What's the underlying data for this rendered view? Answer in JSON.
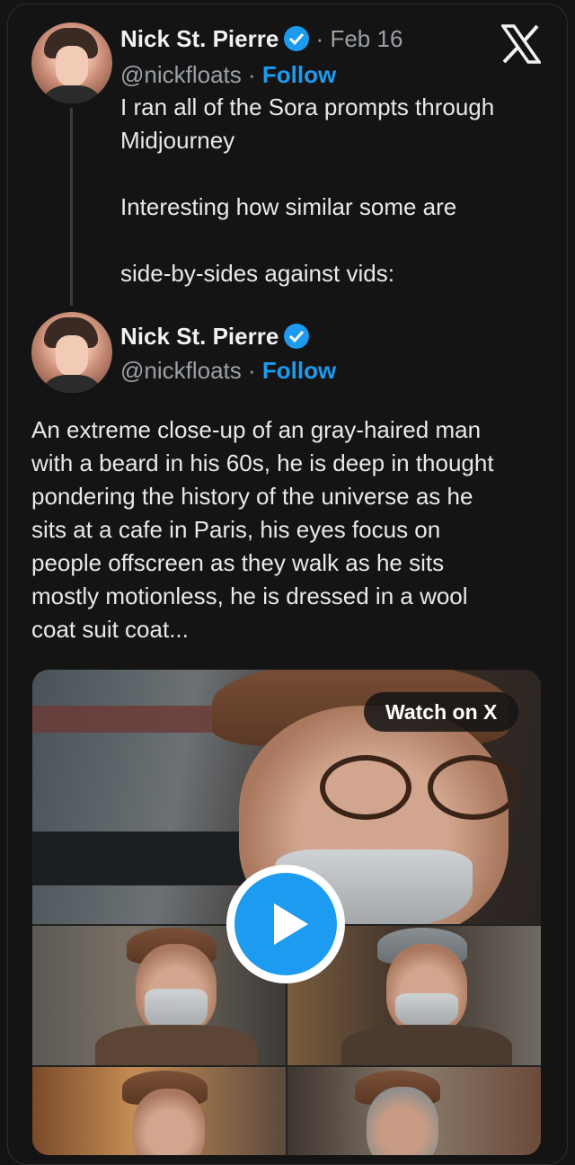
{
  "tweet1": {
    "name": "Nick St. Pierre",
    "date_sep": "·",
    "date": "Feb 16",
    "handle": "@nickfloats",
    "handle_sep": "·",
    "follow": "Follow",
    "text": "I ran all of the Sora prompts through\nMidjourney\n\nInteresting how similar some are\n\nside-by-sides against vids:"
  },
  "tweet2": {
    "name": "Nick St. Pierre",
    "handle": "@nickfloats",
    "handle_sep": "·",
    "follow": "Follow",
    "text": "An extreme close-up of an gray-haired man\nwith a beard in his 60s, he is deep in thought\npondering the history of the universe as he\nsits at a cafe in Paris, his eyes focus on\npeople offscreen as they walk as he sits\nmostly motionless, he is dressed in a wool\ncoat suit coat..."
  },
  "media": {
    "watch_label": "Watch on X"
  },
  "icons": {
    "logo": "x-logo-icon",
    "verified": "verified-badge-icon",
    "play": "play-icon"
  },
  "colors": {
    "background": "#141414",
    "accent": "#1d9bf0",
    "text": "#e7e9ea",
    "muted": "#9aa0a6"
  }
}
